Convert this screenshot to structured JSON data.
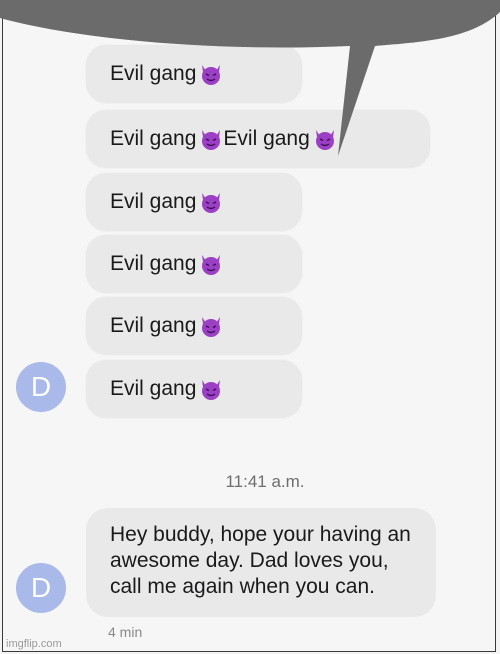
{
  "messages": [
    {
      "text": "Evil gang",
      "emoji": "smiling-devil-emoji"
    },
    {
      "text": "Evil gang",
      "emoji": "smiling-devil-emoji",
      "text2": "Evil gang",
      "emoji2": "smiling-devil-emoji"
    },
    {
      "text": "Evil gang",
      "emoji": "smiling-devil-emoji"
    },
    {
      "text": "Evil gang",
      "emoji": "smiling-devil-emoji"
    },
    {
      "text": "Evil gang",
      "emoji": "smiling-devil-emoji"
    },
    {
      "text": "Evil gang",
      "emoji": "smiling-devil-emoji"
    }
  ],
  "sender_initial": "D",
  "timestamp": "11:41 a.m.",
  "last_message": {
    "text": "Hey buddy, hope your having an awesome day. Dad loves you, call me again when you can.",
    "meta": "4 min"
  },
  "watermark": "imgflip.com",
  "colors": {
    "bubble": "#e9e9ea",
    "avatar": "#a8b9ea",
    "devil": "#9b3fc4",
    "speech_bubble": "#6b6b6b"
  }
}
